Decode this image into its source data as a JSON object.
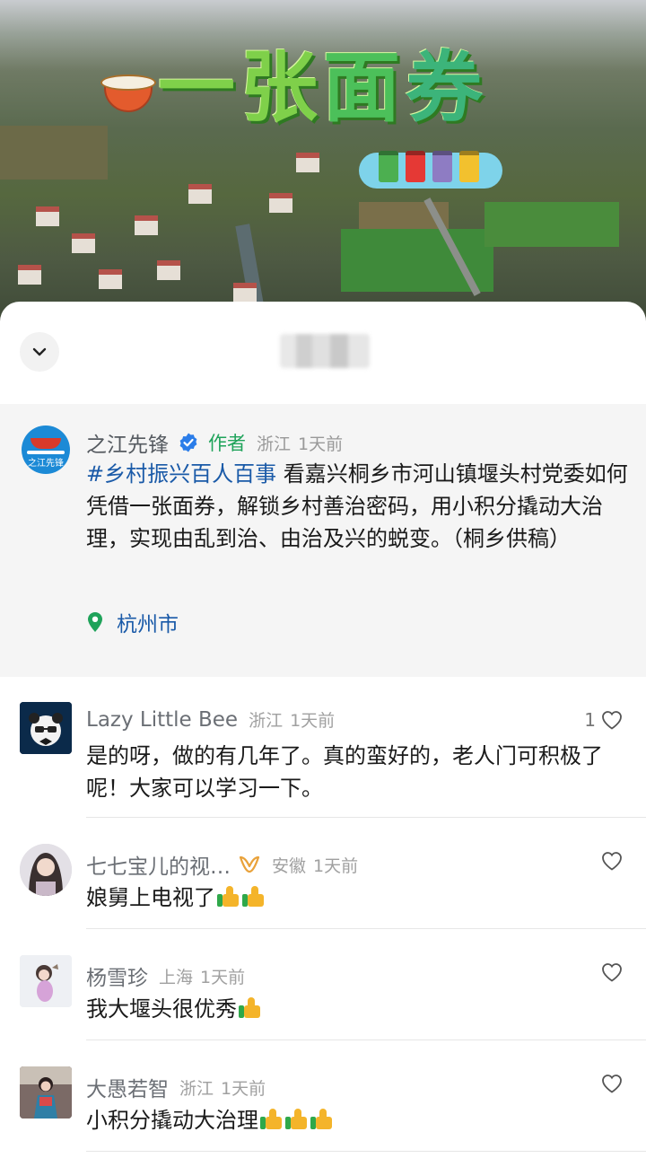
{
  "banner": {
    "title_chars": [
      "一",
      "张",
      "面",
      "券"
    ]
  },
  "post": {
    "author": "之江先锋",
    "avatar_text": "之江先锋",
    "author_tag": "作者",
    "region": "浙江",
    "time": "1天前",
    "hashtag": "#乡村振兴百人百事",
    "body": " 看嘉兴桐乡市河山镇堰头村党委如何凭借一张面券，解锁乡村善治密码，用小积分撬动大治理，实现由乱到治、由治及兴的蜕变。（桐乡供稿）",
    "location": "杭州市"
  },
  "comments": [
    {
      "name": "Lazy Little Bee",
      "region": "浙江",
      "time": "1天前",
      "likes": "1",
      "text": "是的呀，做的有几年了。真的蛮好的，老人门可积极了呢！大家可以学习一下。",
      "thumbs": 0
    },
    {
      "name": "七七宝儿的视…",
      "region": "安徽",
      "time": "1天前",
      "likes": "",
      "text": "娘舅上电视了",
      "thumbs": 2
    },
    {
      "name": "杨雪珍",
      "region": "上海",
      "time": "1天前",
      "likes": "",
      "text": "我大堰头很优秀",
      "thumbs": 1
    },
    {
      "name": "大愚若智",
      "region": "浙江",
      "time": "1天前",
      "likes": "",
      "text": "小积分撬动大治理",
      "thumbs": 3
    }
  ],
  "colors": {
    "hashtag": "#1a5aa8",
    "author_tag": "#1fa35a",
    "thumb": "#f4b42a"
  },
  "icons": {
    "collapse": "chevron-down-icon",
    "verified": "verified-badge-icon",
    "location": "location-pin-icon",
    "like": "heart-outline-icon",
    "thumbs_up": "thumbs-up-emoji",
    "vip": "vip-badge-icon"
  }
}
